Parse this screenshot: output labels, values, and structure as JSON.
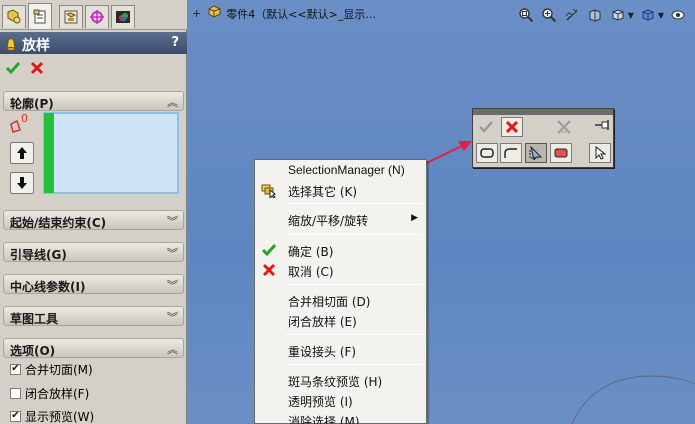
{
  "panel": {
    "title": "放样",
    "help": "?",
    "sections": {
      "profile": "轮廓(P)",
      "start_end": "起始/结束约束(C)",
      "guide": "引导线(G)",
      "centerline": "中心线参数(I)",
      "sketch_tools": "草图工具",
      "options": "选项(O)"
    },
    "profile_badge": "0",
    "options": [
      {
        "label": "合并切面(M)",
        "checked": true
      },
      {
        "label": "闭合放样(F)",
        "checked": false
      },
      {
        "label": "显示预览(W)",
        "checked": true
      }
    ]
  },
  "graphics": {
    "tree_item": "零件4（默认<<默认>_显示..."
  },
  "context_menu": {
    "items": [
      "SelectionManager (N)",
      "选择其它 (K)",
      "缩放/平移/旋转",
      "确定 (B)",
      "取消 (C)",
      "合并相切面 (D)",
      "闭合放样 (E)",
      "重设接头 (F)",
      "斑马条纹预览 (H)",
      "透明预览 (I)",
      "消除选择 (M)"
    ]
  },
  "colors": {
    "accent_green": "#1fc23a",
    "cancel_red": "#e01818",
    "arrow_red": "#e0204a",
    "viewport_blue": "#6a8fc4"
  }
}
